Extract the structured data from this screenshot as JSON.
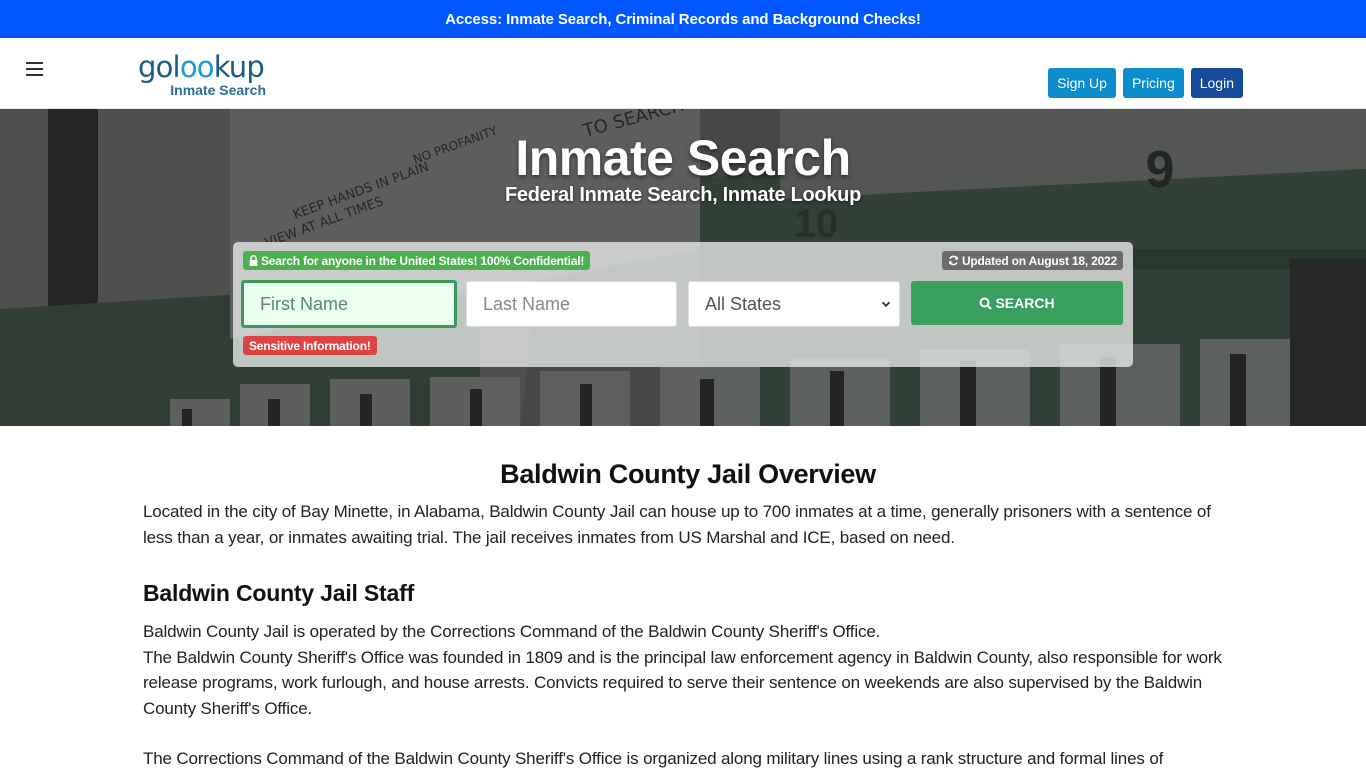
{
  "topbar": {
    "text": "Access: Inmate Search, Criminal Records and Background Checks!",
    "bg_color": "#0057ff"
  },
  "header": {
    "logo": {
      "word_prefix": "gol",
      "word_oo": "oo",
      "word_suffix": "kup",
      "subtitle": "Inmate Search"
    },
    "menu_icon": "hamburger-icon",
    "nav": {
      "signup": "Sign Up",
      "pricing": "Pricing",
      "login": "Login"
    }
  },
  "hero": {
    "title": "Inmate Search",
    "subtitle": "Federal Inmate Search, Inmate Lookup",
    "search": {
      "confidential_badge": "Search for anyone in the United States! 100% Confidential!",
      "confidential_icon": "lock-icon",
      "updated_badge": "Updated on August 18, 2022",
      "updated_icon": "refresh-icon",
      "first_name_placeholder": "First Name",
      "first_name_value": "",
      "last_name_placeholder": "Last Name",
      "last_name_value": "",
      "state_selected": "All States",
      "search_button": "SEARCH",
      "search_icon": "search-icon",
      "sensitive_badge": "Sensitive Information!"
    }
  },
  "content": {
    "overview_heading": "Baldwin County Jail Overview",
    "overview_paragraph": "Located in the city of Bay Minette, in Alabama, Baldwin County Jail can house up to 700 inmates at a time, generally prisoners with a sentence of less than a year, or inmates awaiting trial. The jail receives inmates from US Marshal and ICE, based on need.",
    "staff_heading": "Baldwin County Jail Staff",
    "staff_line1": "Baldwin County Jail is operated by the Corrections Command of the Baldwin County Sheriff's Office.",
    "staff_line2": "The Baldwin County Sheriff's Office was founded in 1809 and is the principal law enforcement agency in Baldwin County, also responsible for work release programs, work furlough, and house arrests. Convicts required to serve their sentence on weekends are also supervised by the Baldwin County Sheriff's Office.",
    "corrections_paragraph": "The Corrections Command of the Baldwin County Sheriff's Office is organized along military lines using a rank structure and formal lines of"
  }
}
